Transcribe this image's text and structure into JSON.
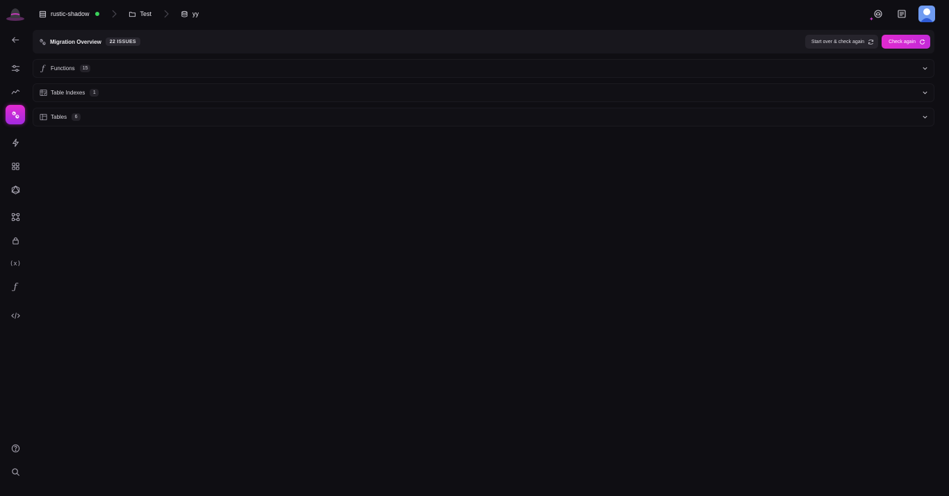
{
  "breadcrumb": {
    "server": "rustic-shadow",
    "project": "Test",
    "database": "yy"
  },
  "overview": {
    "title": "Migration Overview",
    "issues_badge": "22 ISSUES",
    "start_over_label": "Start over & check again",
    "check_again_label": "Check again"
  },
  "sections": [
    {
      "label": "Functions",
      "count": "15",
      "icon": "function-icon"
    },
    {
      "label": "Table Indexes",
      "count": "1",
      "icon": "index-icon"
    },
    {
      "label": "Tables",
      "count": "6",
      "icon": "table-icon"
    }
  ],
  "sidebar": {
    "variables_glyph": "(x)",
    "functions_glyph": "ƒ"
  },
  "colors": {
    "background": "#0f0e13",
    "panel": "#18171d",
    "accent": "#e02ad0",
    "status_online": "#3ad15a",
    "avatar": "#6f9bf1"
  }
}
